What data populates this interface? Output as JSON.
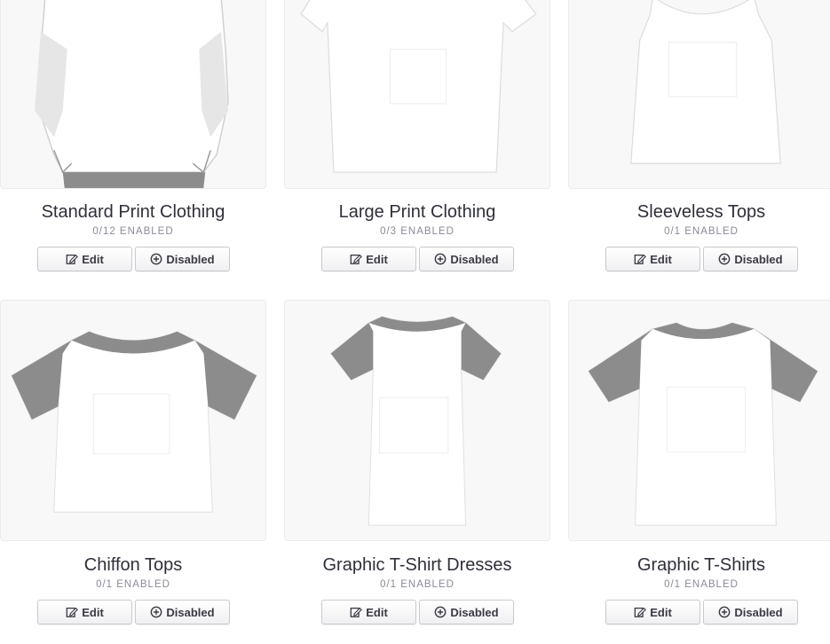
{
  "products": [
    {
      "title": "Standard Print Clothing",
      "enabled": "0/12 ENABLED",
      "edit_label": "Edit",
      "status_label": "Disabled"
    },
    {
      "title": "Large Print Clothing",
      "enabled": "0/3 ENABLED",
      "edit_label": "Edit",
      "status_label": "Disabled"
    },
    {
      "title": "Sleeveless Tops",
      "enabled": "0/1 ENABLED",
      "edit_label": "Edit",
      "status_label": "Disabled"
    },
    {
      "title": "Chiffon Tops",
      "enabled": "0/1 ENABLED",
      "edit_label": "Edit",
      "status_label": "Disabled"
    },
    {
      "title": "Graphic T-Shirt Dresses",
      "enabled": "0/1 ENABLED",
      "edit_label": "Edit",
      "status_label": "Disabled"
    },
    {
      "title": "Graphic T-Shirts",
      "enabled": "0/1 ENABLED",
      "edit_label": "Edit",
      "status_label": "Disabled"
    }
  ],
  "icons": {
    "edit": "edit-icon",
    "disabled": "plus-circle-icon"
  },
  "colors": {
    "sleeve_gray": "#8c8c8c",
    "card_bg": "#f8f8f8",
    "text": "#2f2f3a",
    "subtext": "#8a8a96"
  }
}
